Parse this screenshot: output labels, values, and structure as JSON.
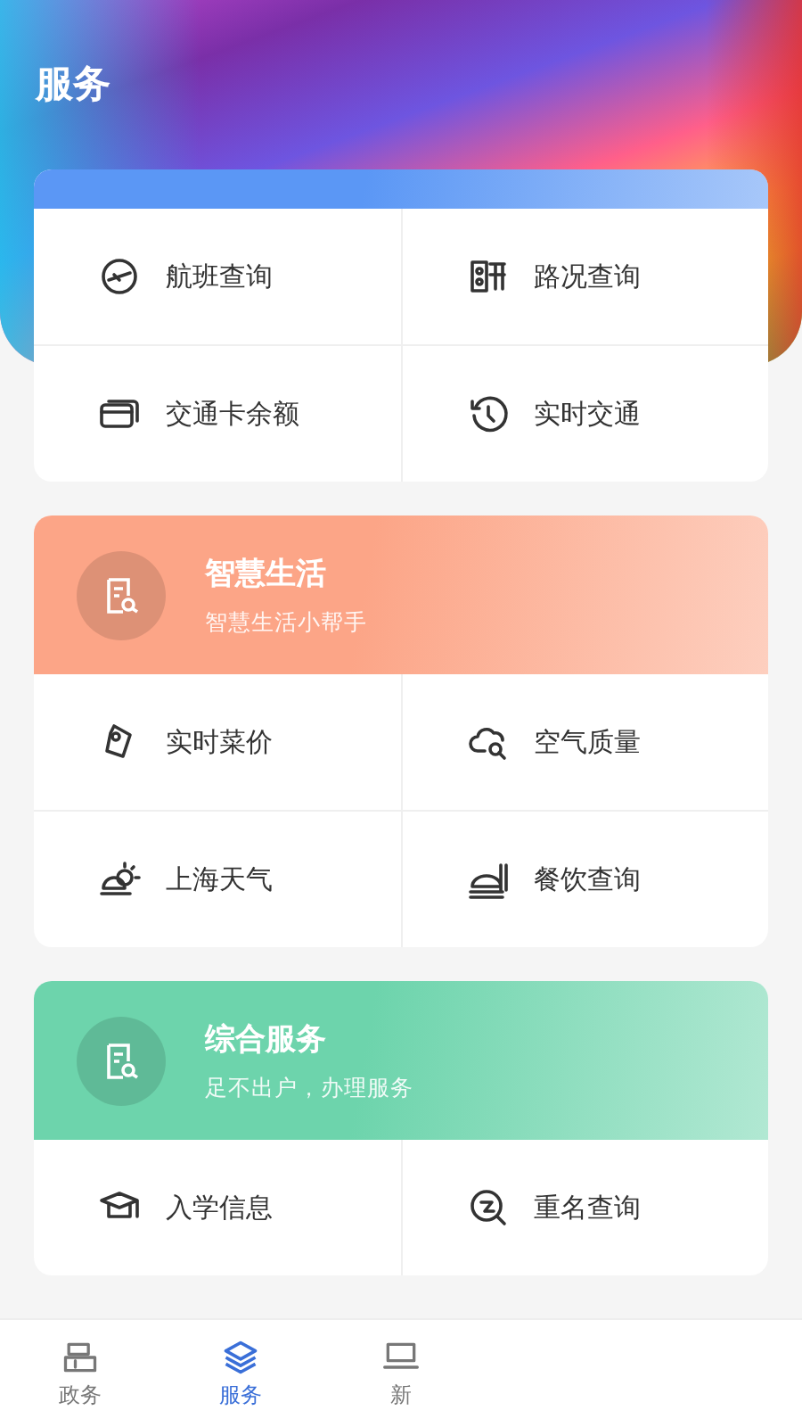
{
  "header": {
    "title": "服务"
  },
  "sections": [
    {
      "color": "#5b97f5",
      "items": [
        {
          "label": "航班查询"
        },
        {
          "label": "路况查询"
        },
        {
          "label": "交通卡余额"
        },
        {
          "label": "实时交通"
        }
      ]
    },
    {
      "color": "#fca587",
      "title": "智慧生活",
      "subtitle": "智慧生活小帮手",
      "items": [
        {
          "label": "实时菜价"
        },
        {
          "label": "空气质量"
        },
        {
          "label": "上海天气"
        },
        {
          "label": "餐饮查询"
        }
      ]
    },
    {
      "color": "#6dd4ac",
      "title": "综合服务",
      "subtitle": "足不出户，办理服务",
      "items": [
        {
          "label": "入学信息"
        },
        {
          "label": "重名查询"
        }
      ]
    }
  ],
  "tab_bar": [
    {
      "label": "政务",
      "selected": false
    },
    {
      "label": "服务",
      "selected": true
    },
    {
      "label": "新",
      "selected": false
    }
  ]
}
